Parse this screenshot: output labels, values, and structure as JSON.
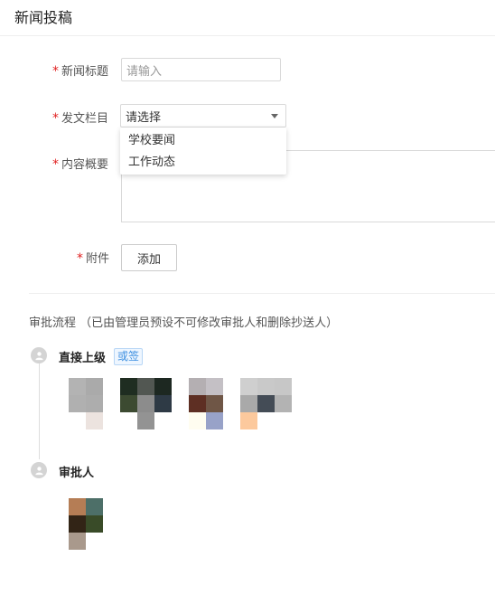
{
  "page": {
    "title": "新闻投稿"
  },
  "form": {
    "required_mark": "*",
    "news_title": {
      "label": "新闻标题",
      "placeholder": "请输入"
    },
    "column": {
      "label": "发文栏目",
      "value": "请选择",
      "options": [
        "学校要闻",
        "工作动态"
      ]
    },
    "summary": {
      "label": "内容概要"
    },
    "attachment": {
      "label": "附件",
      "add_button": "添加"
    }
  },
  "approval": {
    "title": "审批流程 （已由管理员预设不可修改审批人和删除抄送人）",
    "nodes": [
      {
        "name": "直接上级",
        "badge": "或签",
        "avatars": [
          [
            "#b3b3b3",
            "#aaaaaa",
            "#ffffff",
            "#b0b0b0",
            "#adadad",
            "#ffffff",
            "#ffffff",
            "#ece3df",
            "#ffffff"
          ],
          [
            "#1f2d21",
            "#525752",
            "#1d2821",
            "#3c4a31",
            "#8c8c8c",
            "#2e3a45",
            "#ffffff",
            "#939393",
            "#ffffff"
          ],
          [
            "#b4afb2",
            "#c4c0c5",
            "#ffffff",
            "#5e2f23",
            "#6f5646",
            "#ffffff",
            "#fffdf0",
            "#98a2c8",
            "#ffffff"
          ],
          [
            "#cfcfcf",
            "#c9c9c9",
            "#c7c7c7",
            "#a9a9a9",
            "#444c56",
            "#b3b3b3",
            "#fcc99d",
            "#ffffff",
            "#ffffff"
          ]
        ]
      },
      {
        "name": "审批人",
        "avatars": [
          [
            "#b57d55",
            "#4d6f68",
            "#ffffff",
            "#322416",
            "#394b28",
            "#ffffff",
            "#a9998c",
            "#ffffff",
            "#ffffff"
          ]
        ]
      }
    ]
  }
}
